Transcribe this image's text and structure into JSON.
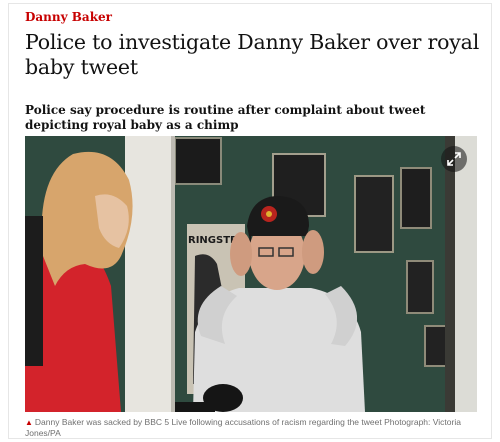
{
  "article": {
    "kicker": "Danny Baker",
    "headline": "Police to investigate Danny Baker over royal baby tweet",
    "standfirst": "Police say procedure is routine after complaint about tweet depicting royal baby as a chimp",
    "image": {
      "poster_text": "RINGSTEEN",
      "expand_icon": "expand-icon"
    },
    "caption": {
      "icon": "triangle-icon",
      "text": "Danny Baker was sacked by BBC 5 Live following accusations of racism regarding the tweet Photograph: Victoria Jones/PA"
    }
  },
  "colors": {
    "accent": "#c70000",
    "text": "#121212",
    "caption": "#707070"
  }
}
